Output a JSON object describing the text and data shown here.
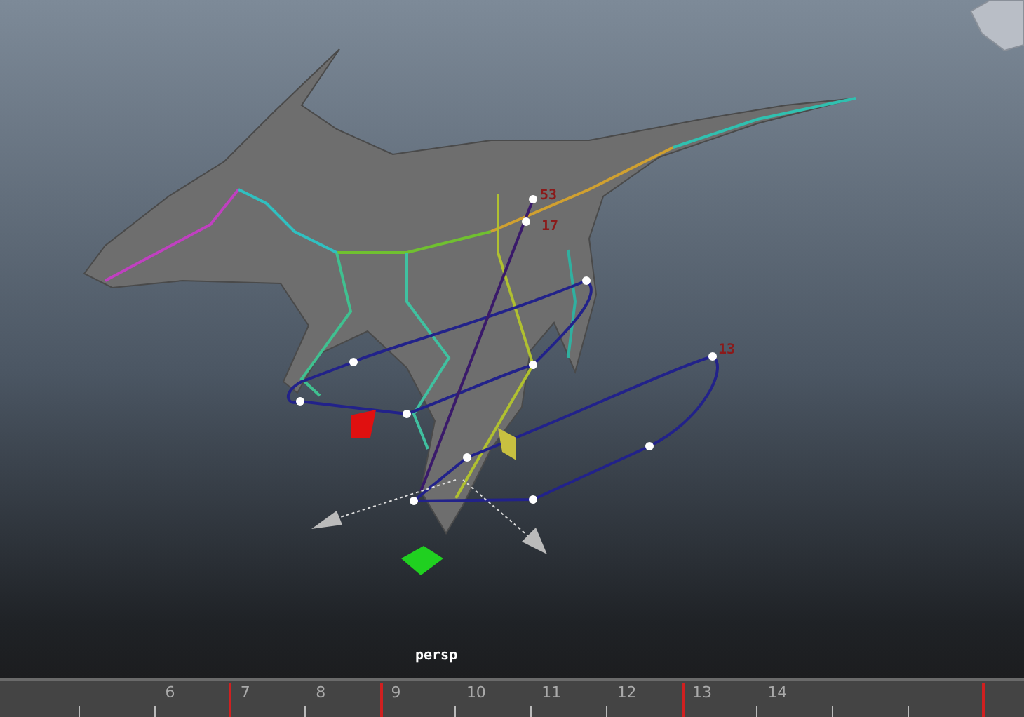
{
  "viewport": {
    "camera_label": "persp",
    "path_labels": [
      {
        "text": "53"
      },
      {
        "text": "17"
      },
      {
        "text": "13"
      }
    ]
  },
  "timeline": {
    "ticks": [
      {
        "key": false
      },
      {
        "label": "6",
        "key": false
      },
      {
        "label": "7",
        "key": true
      },
      {
        "label": "8",
        "key": false
      },
      {
        "label": "9",
        "key": true
      },
      {
        "label": "10",
        "key": false
      },
      {
        "label": "11",
        "key": false
      },
      {
        "label": "12",
        "key": false
      },
      {
        "label": "13",
        "key": true
      },
      {
        "label": "14",
        "key": false
      },
      {
        "key": false
      },
      {
        "key": false
      },
      {
        "key": true
      }
    ]
  }
}
